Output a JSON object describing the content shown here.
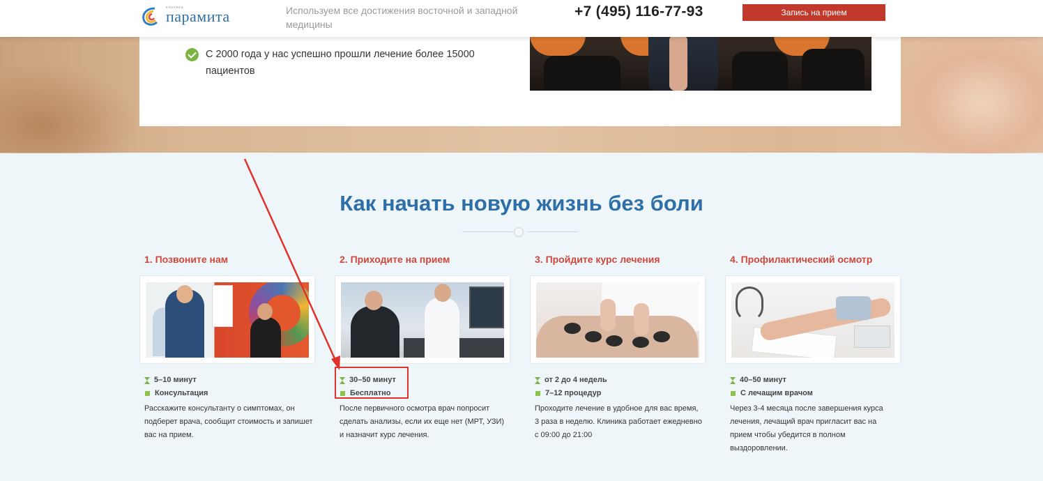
{
  "header": {
    "logo_small": "клиника",
    "logo_text": "парамита",
    "tagline": "Используем все достижения восточной и западной медицины",
    "phone": "+7 (495) 116-77-93",
    "book_button": "Запись на прием"
  },
  "hero": {
    "point": "С 2000 года у нас успешно прошли лечение более 15000 пациентов"
  },
  "section": {
    "title": "Как начать новую жизнь без боли"
  },
  "steps": [
    {
      "title": "1. Позвоните нам",
      "duration": "5–10 минут",
      "detail": "Консультация",
      "description": "Расскажите консультанту о симптомах, он подберет врача, сообщит стоимость и запишет вас на прием."
    },
    {
      "title": "2. Приходите на прием",
      "duration": "30–50 минут",
      "detail": "Бесплатно",
      "description": "После первичного осмотра врач попросит сделать анализы, если их еще нет (МРТ, УЗИ) и назначит курс лечения."
    },
    {
      "title": "3. Пройдите курс лечения",
      "duration": "от 2 до 4 недель",
      "detail": "7–12 процедур",
      "description": "Проходите лечение в удобное для вас время, 3 раза в неделю. Клиника работает ежедневно с 09:00 до 21:00"
    },
    {
      "title": "4. Профилактический осмотр",
      "duration": "40–50 минут",
      "detail": "С лечащим врачом",
      "description": "Через 3-4 месяца после завершения курса лечения, лечащий врач пригласит вас на прием чтобы убедится в полном выздоровлении."
    }
  ],
  "colors": {
    "accent_red": "#c0392b",
    "title_blue": "#2f6fa8",
    "icon_green": "#7cb342",
    "annotation_red": "#e0312a"
  }
}
